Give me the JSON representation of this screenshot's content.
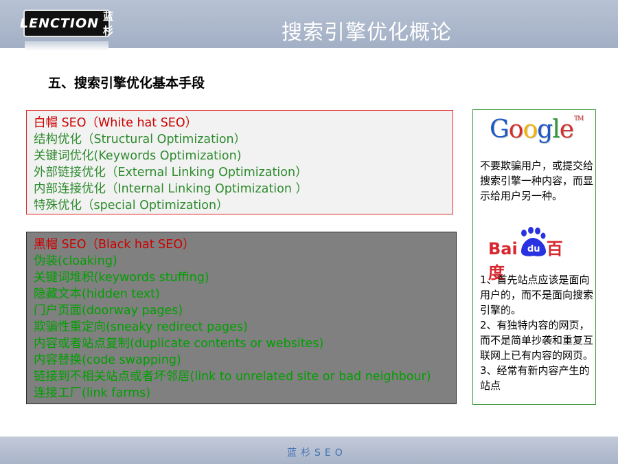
{
  "header": {
    "logo_text": "LENCTION",
    "logo_cn": "蓝杉",
    "title": "搜索引擎优化概论"
  },
  "section_title": "五、搜索引擎优化基本手段",
  "white_hat": {
    "heading": "白帽 SEO（White hat SEO）",
    "items": [
      "结构优化（Structural Optimization）",
      "关键词优化(Keywords Optimization)",
      "外部链接优化（External Linking Optimization）",
      "内部连接优化（Internal Linking Optimization ）",
      "特殊优化（special Optimization）"
    ]
  },
  "black_hat": {
    "heading": "黑帽 SEO（Black hat SEO）",
    "items": [
      "伪装(cloaking)",
      "关键词堆积(keywords stuffing)",
      "隐藏文本(hidden text)",
      "门户页面(doorway pages)",
      "欺骗性重定向(sneaky redirect pages)",
      "内容或者站点复制(duplicate contents or websites)",
      "内容替换(code swapping)",
      "链接到不相关站点或者坏邻居(link to unrelated site or bad neighbour)",
      "连接工厂(link farms)"
    ]
  },
  "sidebar": {
    "google_logo": "Google",
    "google_tm": "TM",
    "google_text": "不要欺骗用户，或提交给搜索引擎一种内容，而显示给用户另一种。",
    "baidu_logo": "Bai百度",
    "baidu_text": [
      "1、首先站点应该是面向用户的，而不是面向搜索引擎的。",
      "2、有独特内容的网页，而不是简单抄袭和重复互联网上已有内容的网页。",
      "3、经常有新内容产生的站点"
    ]
  },
  "footer": {
    "text": "蓝杉SEO"
  },
  "colors": {
    "header_bg": "#a9b4c9",
    "white_hat_border": "#e22222",
    "heading_red": "#cc0000",
    "item_green": "#2e8b2e",
    "black_box_bg": "#808080",
    "sidebar_border": "#3a9a3a"
  }
}
